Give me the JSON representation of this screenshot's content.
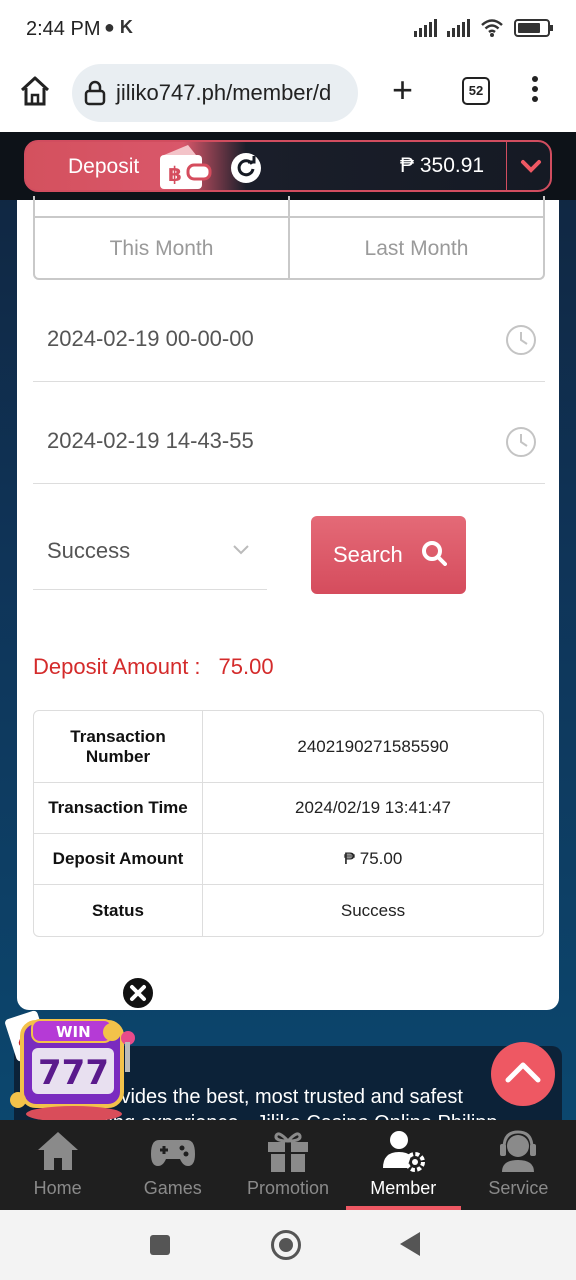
{
  "status_bar": {
    "time": "2:44 PM",
    "carrier_icon": "K"
  },
  "browser": {
    "url": "jiliko747.ph/member/d",
    "tab_count": "52"
  },
  "topbar": {
    "deposit_label": "Deposit",
    "balance": "₱ 350.91"
  },
  "filters": {
    "period_options": [
      "This Month",
      "Last Month"
    ],
    "start_time": "2024-02-19 00-00-00",
    "end_time": "2024-02-19 14-43-55",
    "status_selected": "Success",
    "search_label": "Search"
  },
  "summary": {
    "label": "Deposit Amount :",
    "value": "75.00"
  },
  "transaction": {
    "rows": [
      {
        "key": "Transaction Number",
        "value": "2402190271585590"
      },
      {
        "key": "Transaction Time",
        "value": "2024/02/19 13:41:47"
      },
      {
        "key": "Deposit Amount",
        "value": "₱ 75.00"
      },
      {
        "key": "Status",
        "value": "Success"
      }
    ]
  },
  "promo": {
    "text_line1": "liko provides the best, most trusted and safest",
    "text_line2": "gambling experience - Jiliko Casino Online Philipp",
    "slot_text": "WIN",
    "slot_number": "777"
  },
  "bottom_nav": {
    "items": [
      {
        "label": "Home",
        "icon": "home-icon"
      },
      {
        "label": "Games",
        "icon": "gamepad-icon"
      },
      {
        "label": "Promotion",
        "icon": "gift-icon"
      },
      {
        "label": "Member",
        "icon": "member-settings-icon",
        "active": true
      },
      {
        "label": "Service",
        "icon": "headset-icon"
      }
    ]
  },
  "colors": {
    "accent": "#e05a69",
    "danger_text": "#d42b2b",
    "nav_bg": "#1f1f1f"
  }
}
